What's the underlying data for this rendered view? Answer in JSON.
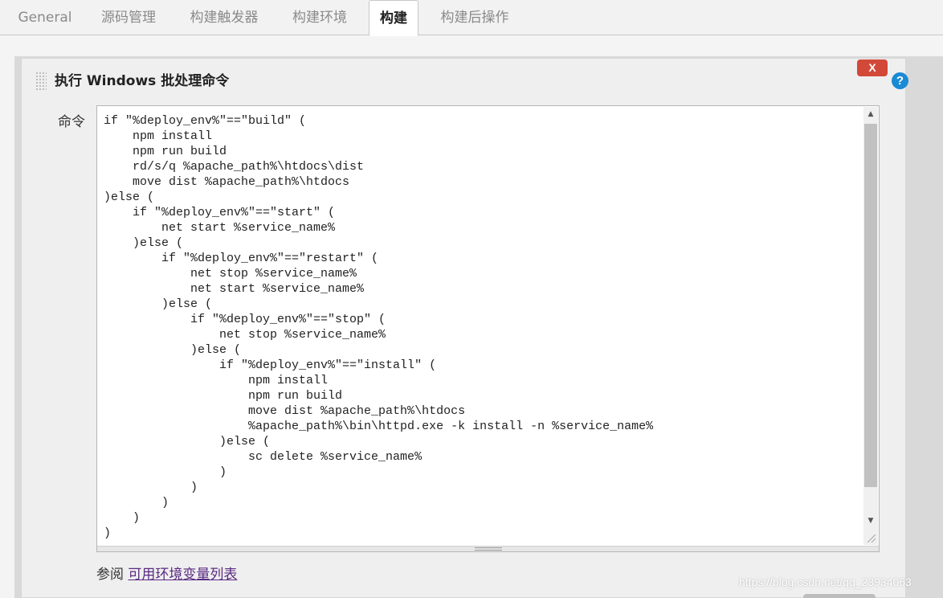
{
  "tabs": [
    {
      "label": "General"
    },
    {
      "label": "源码管理"
    },
    {
      "label": "构建触发器"
    },
    {
      "label": "构建环境"
    },
    {
      "label": "构建",
      "active": true
    },
    {
      "label": "构建后操作"
    }
  ],
  "step": {
    "title": "执行 Windows 批处理命令",
    "delete_label": "X",
    "help_label": "?"
  },
  "command": {
    "label": "命令",
    "value": "if \"%deploy_env%\"==\"build\" (\n    npm install\n    npm run build\n    rd/s/q %apache_path%\\htdocs\\dist\n    move dist %apache_path%\\htdocs\n)else (\n    if \"%deploy_env%\"==\"start\" (\n        net start %service_name%\n    )else (\n        if \"%deploy_env%\"==\"restart\" (\n            net stop %service_name%\n            net start %service_name%\n        )else (\n            if \"%deploy_env%\"==\"stop\" (\n                net stop %service_name%\n            )else (\n                if \"%deploy_env%\"==\"install\" (\n                    npm install\n                    npm run build\n                    move dist %apache_path%\\htdocs\n                    %apache_path%\\bin\\httpd.exe -k install -n %service_name%\n                )else (\n                    sc delete %service_name%\n                )\n            )\n        )\n    )\n)"
  },
  "see_also": {
    "prefix": "参阅",
    "link_text": "可用环境变量列表"
  },
  "watermark": "https://blog.csdn.net/qq_23934063",
  "colors": {
    "delete": "#d24939",
    "help": "#1a8ad4",
    "link": "#5a2a82"
  }
}
